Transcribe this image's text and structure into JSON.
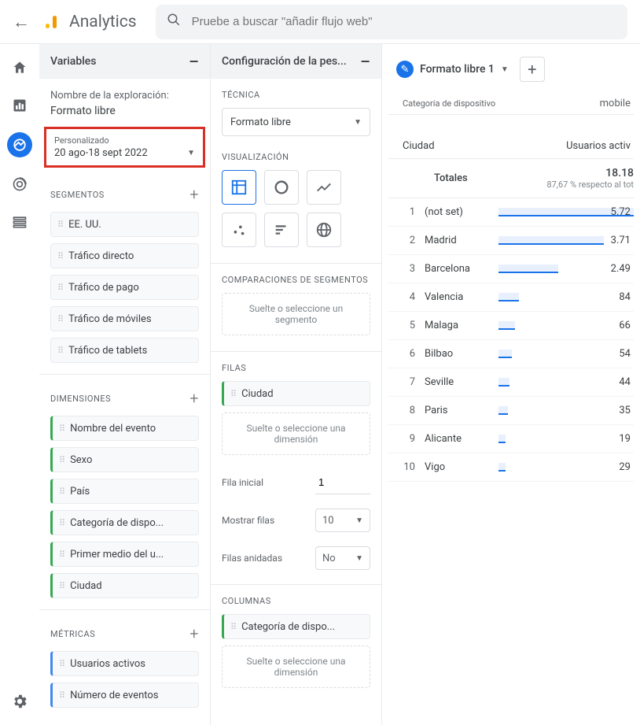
{
  "header": {
    "app_name": "Analytics",
    "search_placeholder": "Pruebe a buscar \"añadir flujo web\""
  },
  "variables_panel": {
    "title": "Variables",
    "exploration_name_label": "Nombre de la exploración:",
    "exploration_name_value": "Formato libre",
    "date_preset": "Personalizado",
    "date_range": "20 ago-18 sept 2022",
    "sections": {
      "segments": {
        "title": "SEGMENTOS",
        "items": [
          "EE. UU.",
          "Tráfico directo",
          "Tráfico de pago",
          "Tráfico de móviles",
          "Tráfico de tablets"
        ]
      },
      "dimensions": {
        "title": "DIMENSIONES",
        "items": [
          "Nombre del evento",
          "Sexo",
          "País",
          "Categoría de dispo...",
          "Primer medio del u...",
          "Ciudad"
        ]
      },
      "metrics": {
        "title": "MÉTRICAS",
        "items": [
          "Usuarios activos",
          "Número de eventos"
        ]
      }
    }
  },
  "config_panel": {
    "title": "Configuración de la pes...",
    "technique_label": "TÉCNICA",
    "technique_value": "Formato libre",
    "viz_label": "VISUALIZACIÓN",
    "compare_label": "COMPARACIONES DE SEGMENTOS",
    "compare_drop": "Suelte o seleccione un segmento",
    "rows_label": "FILAS",
    "rows_chip": "Ciudad",
    "rows_drop": "Suelte o seleccione una dimensión",
    "start_row_label": "Fila inicial",
    "start_row_value": "1",
    "show_rows_label": "Mostrar filas",
    "show_rows_value": "10",
    "nested_label": "Filas anidadas",
    "nested_value": "No",
    "cols_label": "COLUMNAS",
    "cols_chip": "Categoría de dispo...",
    "cols_drop": "Suelte o seleccione una dimensión"
  },
  "report": {
    "tab_name": "Formato libre 1",
    "device_cat_label": "Categoría de dispositivo",
    "device_value": "mobile",
    "dim_header": "Ciudad",
    "metric_header": "Usuarios activ",
    "totals_label": "Totales",
    "totals_value": "18.18",
    "totals_sub": "87,67 % respecto al tot",
    "rows": [
      {
        "idx": "1",
        "city": "(not set)",
        "value": "5.72",
        "barpct": 100
      },
      {
        "idx": "2",
        "city": "Madrid",
        "value": "3.71",
        "barpct": 78
      },
      {
        "idx": "3",
        "city": "Barcelona",
        "value": "2.49",
        "barpct": 44
      },
      {
        "idx": "4",
        "city": "Valencia",
        "value": "84",
        "barpct": 15
      },
      {
        "idx": "5",
        "city": "Malaga",
        "value": "66",
        "barpct": 12
      },
      {
        "idx": "6",
        "city": "Bilbao",
        "value": "54",
        "barpct": 10
      },
      {
        "idx": "7",
        "city": "Seville",
        "value": "44",
        "barpct": 8
      },
      {
        "idx": "8",
        "city": "Paris",
        "value": "35",
        "barpct": 7
      },
      {
        "idx": "9",
        "city": "Alicante",
        "value": "19",
        "barpct": 5
      },
      {
        "idx": "10",
        "city": "Vigo",
        "value": "29",
        "barpct": 5
      }
    ]
  }
}
